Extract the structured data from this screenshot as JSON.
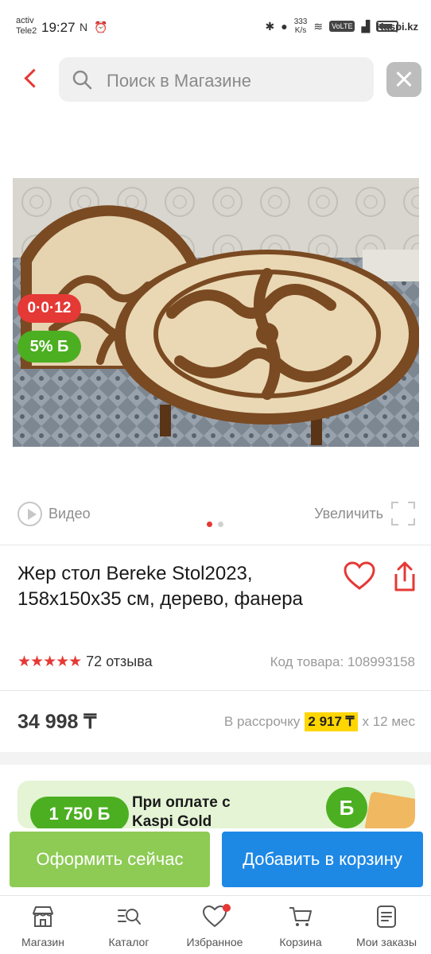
{
  "status_bar": {
    "carrier_line1": "activ",
    "carrier_line2": "Tele2",
    "time": "19:27",
    "left_icons": "N ⏰",
    "speed_line1": "333",
    "speed_line2": "K/s",
    "volte": "VoLTE",
    "battery_site": "Kaspi.kz"
  },
  "header": {
    "search_placeholder": "Поиск в Магазине"
  },
  "product": {
    "installment_badge": "0·0·12",
    "bonus_badge": "5% Б",
    "video_label": "Видео",
    "zoom_label": "Увеличить",
    "title": "Жер стол Bereke Stol2023, 158x150x35 см, дерево, фанера",
    "stars": "★★★★★",
    "reviews": "72 отзыва",
    "code": "Код товара: 108993158",
    "price": "34 998 ₸",
    "installment_prefix": "В рассрочку",
    "installment_amount": "2 917 ₸",
    "installment_suffix": "x 12 мес",
    "image_count": 2,
    "active_image": 1
  },
  "promo": {
    "bonus": "1 750 Б",
    "text_line1": "При оплате с",
    "text_line2": "Kaspi Gold",
    "coin": "Б"
  },
  "actions": {
    "buy_now": "Оформить сейчас",
    "add_to_cart": "Добавить в корзину"
  },
  "tabs": [
    {
      "label": "Магазин",
      "icon": "shop-icon"
    },
    {
      "label": "Каталог",
      "icon": "catalog-search-icon"
    },
    {
      "label": "Избранное",
      "icon": "heart-icon"
    },
    {
      "label": "Корзина",
      "icon": "cart-icon"
    },
    {
      "label": "Мои заказы",
      "icon": "orders-icon"
    }
  ],
  "colors": {
    "accent_red": "#e53935",
    "bonus_green": "#4caf21",
    "buy_now_green": "#8dcb55",
    "cart_blue": "#1e88e5",
    "installment_yellow": "#ffd600"
  }
}
